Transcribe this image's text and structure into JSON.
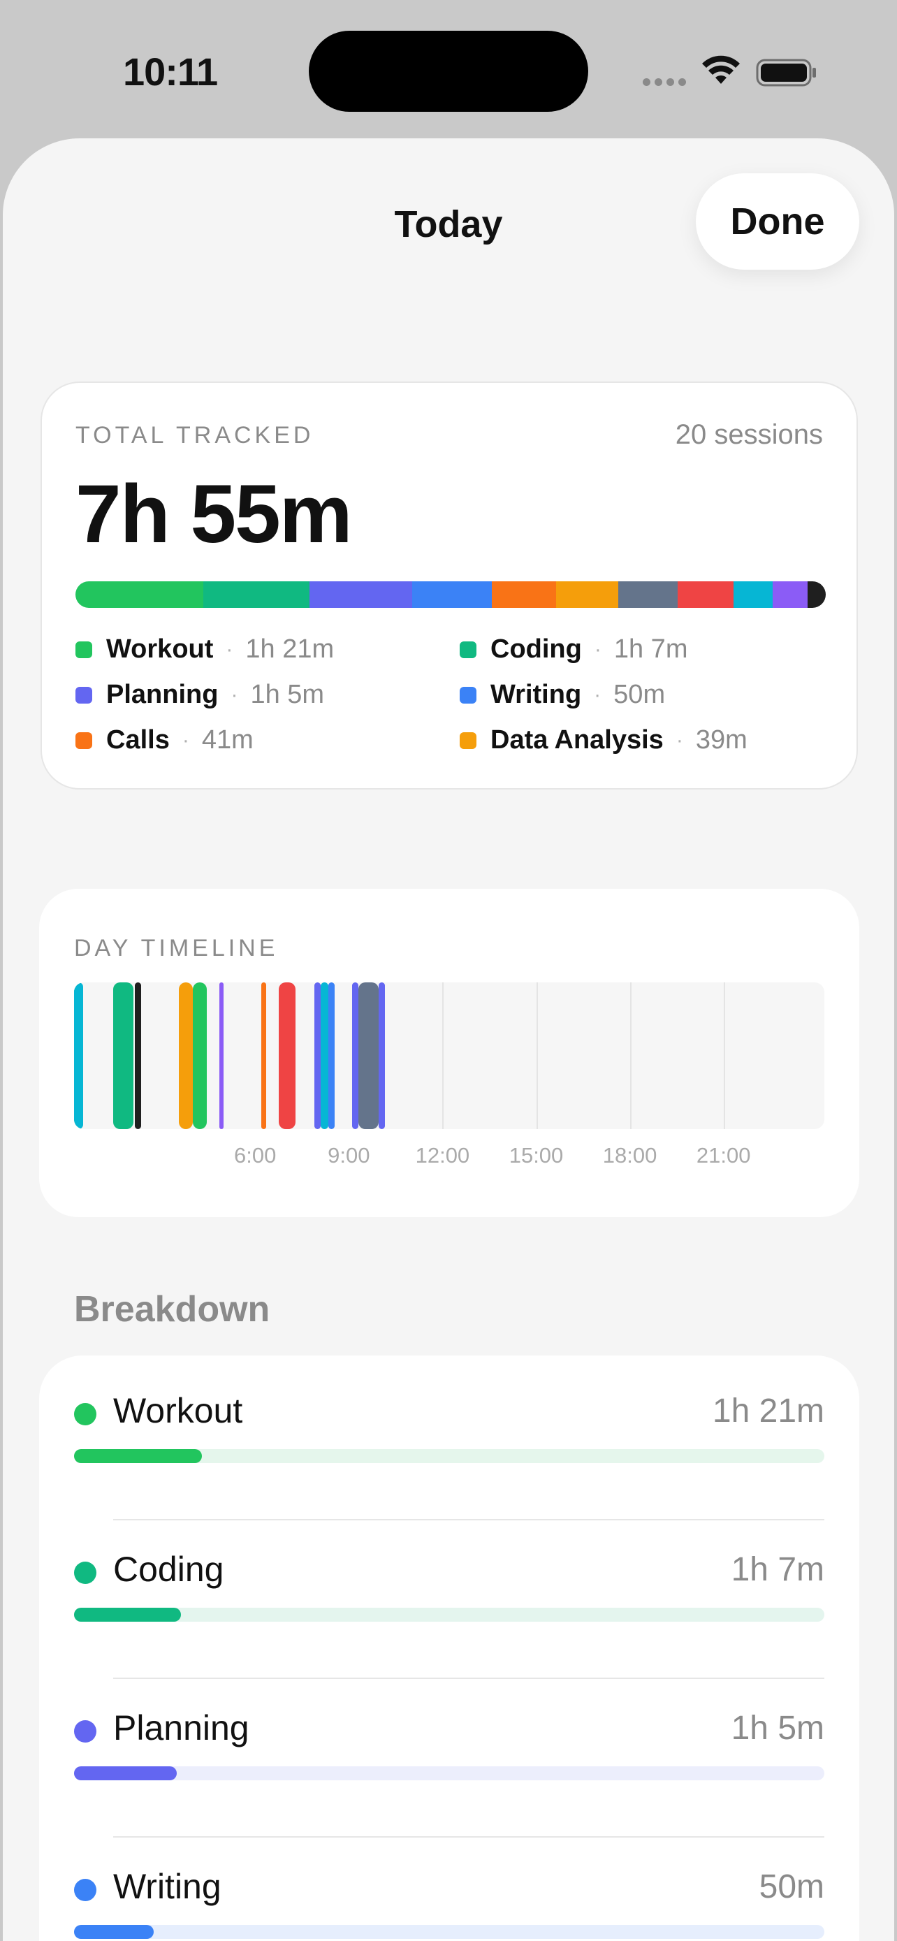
{
  "status": {
    "time": "10:11"
  },
  "nav": {
    "title": "Today",
    "done_label": "Done"
  },
  "summary": {
    "label": "TOTAL TRACKED",
    "sessions": "20 sessions",
    "total": "7h 55m",
    "bar": [
      {
        "color": "#22c55e",
        "share": 0.17
      },
      {
        "color": "#10b981",
        "share": 0.142
      },
      {
        "color": "#6366f1",
        "share": 0.137
      },
      {
        "color": "#3b82f6",
        "share": 0.106
      },
      {
        "color": "#f97316",
        "share": 0.086
      },
      {
        "color": "#f59e0b",
        "share": 0.082
      },
      {
        "color": "#64748b",
        "share": 0.08
      },
      {
        "color": "#ef4444",
        "share": 0.074
      },
      {
        "color": "#06b6d4",
        "share": 0.052
      },
      {
        "color": "#8b5cf6",
        "share": 0.047
      },
      {
        "color": "#1f1f1f",
        "share": 0.024
      }
    ],
    "legend": [
      {
        "name": "Workout",
        "value": "1h 21m",
        "color": "#22c55e"
      },
      {
        "name": "Coding",
        "value": "1h 7m",
        "color": "#10b981"
      },
      {
        "name": "Planning",
        "value": "1h 5m",
        "color": "#6366f1"
      },
      {
        "name": "Writing",
        "value": "50m",
        "color": "#3b82f6"
      },
      {
        "name": "Calls",
        "value": "41m",
        "color": "#f97316"
      },
      {
        "name": "Data Analysis",
        "value": "39m",
        "color": "#f59e0b"
      }
    ],
    "separator": "·"
  },
  "timeline": {
    "label": "DAY TIMELINE",
    "ticks": [
      "6:00",
      "9:00",
      "12:00",
      "15:00",
      "18:00",
      "21:00"
    ],
    "segments": [
      {
        "start": 0.1,
        "end": 0.45,
        "color": "#10b981"
      },
      {
        "start": 0.2,
        "end": 0.5,
        "color": "#06b6d4"
      },
      {
        "start": 1.45,
        "end": 2.1,
        "color": "#10b981"
      },
      {
        "start": 2.15,
        "end": 2.35,
        "color": "#1f1f1f"
      },
      {
        "start": 3.55,
        "end": 4.0,
        "color": "#f59e0b"
      },
      {
        "start": 4.0,
        "end": 4.45,
        "color": "#22c55e"
      },
      {
        "start": 4.85,
        "end": 5.0,
        "color": "#8b5cf6"
      },
      {
        "start": 6.2,
        "end": 6.35,
        "color": "#f97316"
      },
      {
        "start": 6.75,
        "end": 7.3,
        "color": "#ef4444"
      },
      {
        "start": 7.9,
        "end": 8.1,
        "color": "#6366f1"
      },
      {
        "start": 8.1,
        "end": 8.35,
        "color": "#06b6d4"
      },
      {
        "start": 8.35,
        "end": 8.55,
        "color": "#3b82f6"
      },
      {
        "start": 9.1,
        "end": 9.3,
        "color": "#6366f1"
      },
      {
        "start": 9.3,
        "end": 9.95,
        "color": "#64748b"
      },
      {
        "start": 9.95,
        "end": 10.15,
        "color": "#6366f1"
      }
    ]
  },
  "breakdown": {
    "title": "Breakdown",
    "items": [
      {
        "name": "Workout",
        "value": "1h 21m",
        "color": "#22c55e",
        "track": "#e5f6ec",
        "fraction": 0.17
      },
      {
        "name": "Coding",
        "value": "1h 7m",
        "color": "#10b981",
        "track": "#e4f5ee",
        "fraction": 0.142
      },
      {
        "name": "Planning",
        "value": "1h 5m",
        "color": "#6366f1",
        "track": "#eceefc",
        "fraction": 0.137
      },
      {
        "name": "Writing",
        "value": "50m",
        "color": "#3b82f6",
        "track": "#e6eefd",
        "fraction": 0.106
      }
    ]
  }
}
